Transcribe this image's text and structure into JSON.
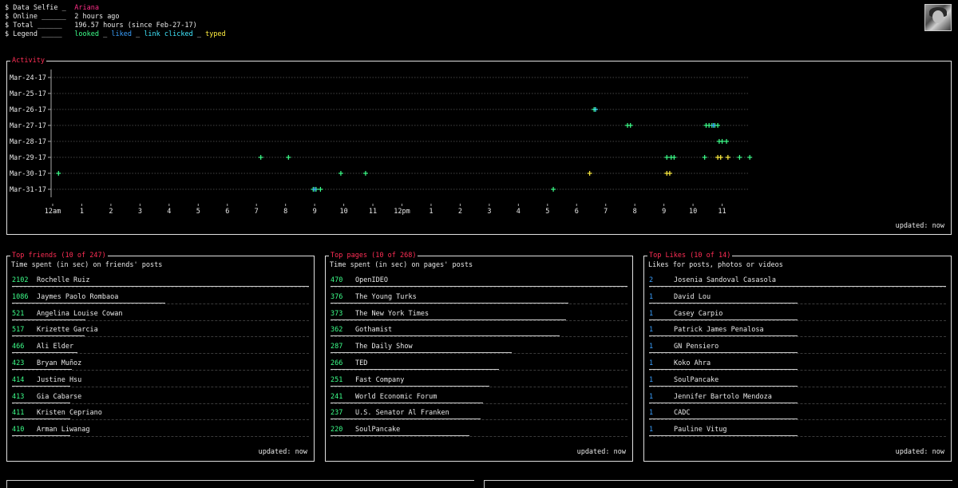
{
  "header": {
    "prompt": "$",
    "rows": [
      {
        "key": "Data Selfie _",
        "value": "Ariana"
      },
      {
        "key": "Online ______",
        "value": "2 hours ago"
      },
      {
        "key": "Total ______",
        "value": "196.57 hours (since Feb-27-17)"
      },
      {
        "key": "Legend _____"
      }
    ],
    "legend": [
      {
        "label": "looked",
        "color": "#3dff8a"
      },
      {
        "label": "liked",
        "color": "#3aa0ff"
      },
      {
        "label": "link clicked",
        "color": "#40e8ff"
      },
      {
        "label": "typed",
        "color": "#ffee40"
      }
    ],
    "legend_sep": "_"
  },
  "activity": {
    "title": "Activity",
    "updated": "updated: now",
    "chart_data": {
      "type": "scatter",
      "title": "Activity",
      "y_categories": [
        "Mar-24-17",
        "Mar-25-17",
        "Mar-26-17",
        "Mar-27-17",
        "Mar-28-17",
        "Mar-29-17",
        "Mar-30-17",
        "Mar-31-17"
      ],
      "x_ticks": [
        "12am",
        "1",
        "2",
        "3",
        "4",
        "5",
        "6",
        "7",
        "8",
        "9",
        "10",
        "11",
        "12pm",
        "1",
        "2",
        "3",
        "4",
        "5",
        "6",
        "7",
        "8",
        "9",
        "10",
        "11"
      ],
      "x_range_hours": [
        0,
        24
      ],
      "grid": true,
      "series": [
        {
          "name": "looked",
          "color": "#3dff8a",
          "points": [
            {
              "day": "Mar-26-17",
              "hour": 18.6
            },
            {
              "day": "Mar-27-17",
              "hour": 19.75
            },
            {
              "day": "Mar-27-17",
              "hour": 19.85
            },
            {
              "day": "Mar-27-17",
              "hour": 22.45
            },
            {
              "day": "Mar-27-17",
              "hour": 22.55
            },
            {
              "day": "Mar-27-17",
              "hour": 22.65
            },
            {
              "day": "Mar-27-17",
              "hour": 22.75
            },
            {
              "day": "Mar-27-17",
              "hour": 22.85
            },
            {
              "day": "Mar-28-17",
              "hour": 22.9
            },
            {
              "day": "Mar-28-17",
              "hour": 23.0
            },
            {
              "day": "Mar-28-17",
              "hour": 23.15
            },
            {
              "day": "Mar-29-17",
              "hour": 7.15
            },
            {
              "day": "Mar-29-17",
              "hour": 8.1
            },
            {
              "day": "Mar-29-17",
              "hour": 21.1
            },
            {
              "day": "Mar-29-17",
              "hour": 21.25
            },
            {
              "day": "Mar-29-17",
              "hour": 21.35
            },
            {
              "day": "Mar-29-17",
              "hour": 22.4
            },
            {
              "day": "Mar-29-17",
              "hour": 23.6
            },
            {
              "day": "Mar-29-17",
              "hour": 23.95
            },
            {
              "day": "Mar-30-17",
              "hour": 0.2
            },
            {
              "day": "Mar-30-17",
              "hour": 9.9
            },
            {
              "day": "Mar-30-17",
              "hour": 10.75
            },
            {
              "day": "Mar-31-17",
              "hour": 8.95
            },
            {
              "day": "Mar-31-17",
              "hour": 9.05
            },
            {
              "day": "Mar-31-17",
              "hour": 9.2
            },
            {
              "day": "Mar-31-17",
              "hour": 17.2
            }
          ]
        },
        {
          "name": "liked",
          "color": "#3aa0ff",
          "points": [
            {
              "day": "Mar-27-17",
              "hour": 22.7
            },
            {
              "day": "Mar-31-17",
              "hour": 9.0
            }
          ]
        },
        {
          "name": "link clicked",
          "color": "#40e8ff",
          "points": [
            {
              "day": "Mar-26-17",
              "hour": 18.65
            }
          ]
        },
        {
          "name": "typed",
          "color": "#ffee40",
          "points": [
            {
              "day": "Mar-29-17",
              "hour": 22.85
            },
            {
              "day": "Mar-29-17",
              "hour": 22.95
            },
            {
              "day": "Mar-29-17",
              "hour": 23.2
            },
            {
              "day": "Mar-30-17",
              "hour": 18.45
            },
            {
              "day": "Mar-30-17",
              "hour": 21.1
            },
            {
              "day": "Mar-30-17",
              "hour": 21.2
            }
          ]
        }
      ]
    }
  },
  "friends": {
    "title": "Top friends (10 of 247)",
    "subtitle": "Time spent (in sec) on friends' posts",
    "updated": "updated: now",
    "number_color": "#3dff8a",
    "items": [
      {
        "value": 2102,
        "name": "Rochelle Ruiz"
      },
      {
        "value": 1086,
        "name": "Jaymes Paolo Rombaoa"
      },
      {
        "value": 521,
        "name": "Angelina Louise Cowan"
      },
      {
        "value": 517,
        "name": "Krizette Garcia"
      },
      {
        "value": 466,
        "name": "Ali Elder"
      },
      {
        "value": 423,
        "name": "Bryan Muñoz"
      },
      {
        "value": 414,
        "name": "Justine Hsu"
      },
      {
        "value": 413,
        "name": "Gia Cabarse"
      },
      {
        "value": 411,
        "name": "Kristen Cepriano"
      },
      {
        "value": 410,
        "name": "Arman Liwanag"
      }
    ]
  },
  "pages": {
    "title": "Top pages (10 of 268)",
    "subtitle": "Time spent (in sec) on pages' posts",
    "updated": "updated: now",
    "number_color": "#3dff8a",
    "items": [
      {
        "value": 470,
        "name": "OpenIDEO"
      },
      {
        "value": 376,
        "name": "The Young Turks"
      },
      {
        "value": 373,
        "name": "The New York Times"
      },
      {
        "value": 362,
        "name": "Gothamist"
      },
      {
        "value": 287,
        "name": "The Daily Show"
      },
      {
        "value": 266,
        "name": "TED"
      },
      {
        "value": 251,
        "name": "Fast Company"
      },
      {
        "value": 241,
        "name": "World Economic Forum"
      },
      {
        "value": 237,
        "name": "U.S. Senator Al Franken"
      },
      {
        "value": 220,
        "name": "SoulPancake"
      }
    ]
  },
  "likes": {
    "title": "Top Likes (10 of 14)",
    "subtitle": "Likes for posts, photos or videos",
    "updated": "updated: now",
    "number_color": "#3aa0ff",
    "items": [
      {
        "value": 2,
        "name": "Josenia Sandoval Casasola"
      },
      {
        "value": 1,
        "name": "David Lou"
      },
      {
        "value": 1,
        "name": "Casey Carpio"
      },
      {
        "value": 1,
        "name": "Patrick James Penalosa"
      },
      {
        "value": 1,
        "name": "GN Pensiero"
      },
      {
        "value": 1,
        "name": "Koko Ahra"
      },
      {
        "value": 1,
        "name": "SoulPancake"
      },
      {
        "value": 1,
        "name": "Jennifer Bartolo Mendoza"
      },
      {
        "value": 1,
        "name": "CADC"
      },
      {
        "value": 1,
        "name": "Pauline Vitug"
      }
    ]
  }
}
